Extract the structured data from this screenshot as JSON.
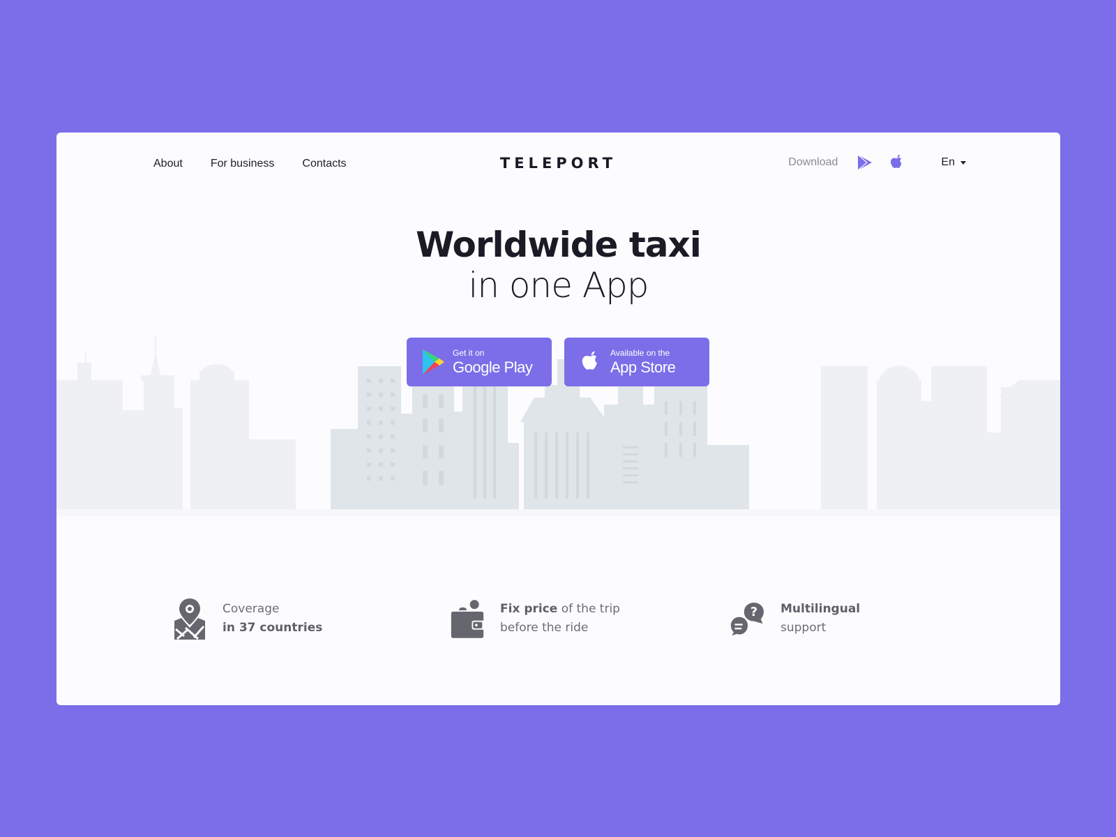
{
  "nav": {
    "links": [
      {
        "label": "About"
      },
      {
        "label": "For business"
      },
      {
        "label": "Contacts"
      }
    ],
    "logo": "TELEPORT",
    "download_label": "Download",
    "download_icons": [
      "google-play-icon",
      "apple-icon"
    ],
    "language": {
      "selected": "En"
    }
  },
  "hero": {
    "title": "Worldwide taxi",
    "subtitle": "in one App",
    "buttons": [
      {
        "small": "Get it on",
        "big": "Google Play",
        "icon": "google-play-icon"
      },
      {
        "small": "Available on the",
        "big": "App Store",
        "icon": "apple-icon"
      }
    ]
  },
  "features": [
    {
      "icon": "map-pin-icon",
      "line1_plain": "Coverage",
      "line2_bold": "in 37 countries"
    },
    {
      "icon": "wallet-icon",
      "line1_bold": "Fix price",
      "line1_plain": " of the trip",
      "line2_plain": "before the ride"
    },
    {
      "icon": "support-chat-icon",
      "line1_bold": "Multilingual",
      "line2_plain": "support"
    }
  ],
  "colors": {
    "brand": "#7b6ee8",
    "card": "#fcfcfe",
    "text_dark": "#1b1b26",
    "text_muted": "#8a8a92",
    "feature_icon": "#66666e",
    "city_front": "#dde3e6",
    "city_back": "#eef0f4"
  }
}
